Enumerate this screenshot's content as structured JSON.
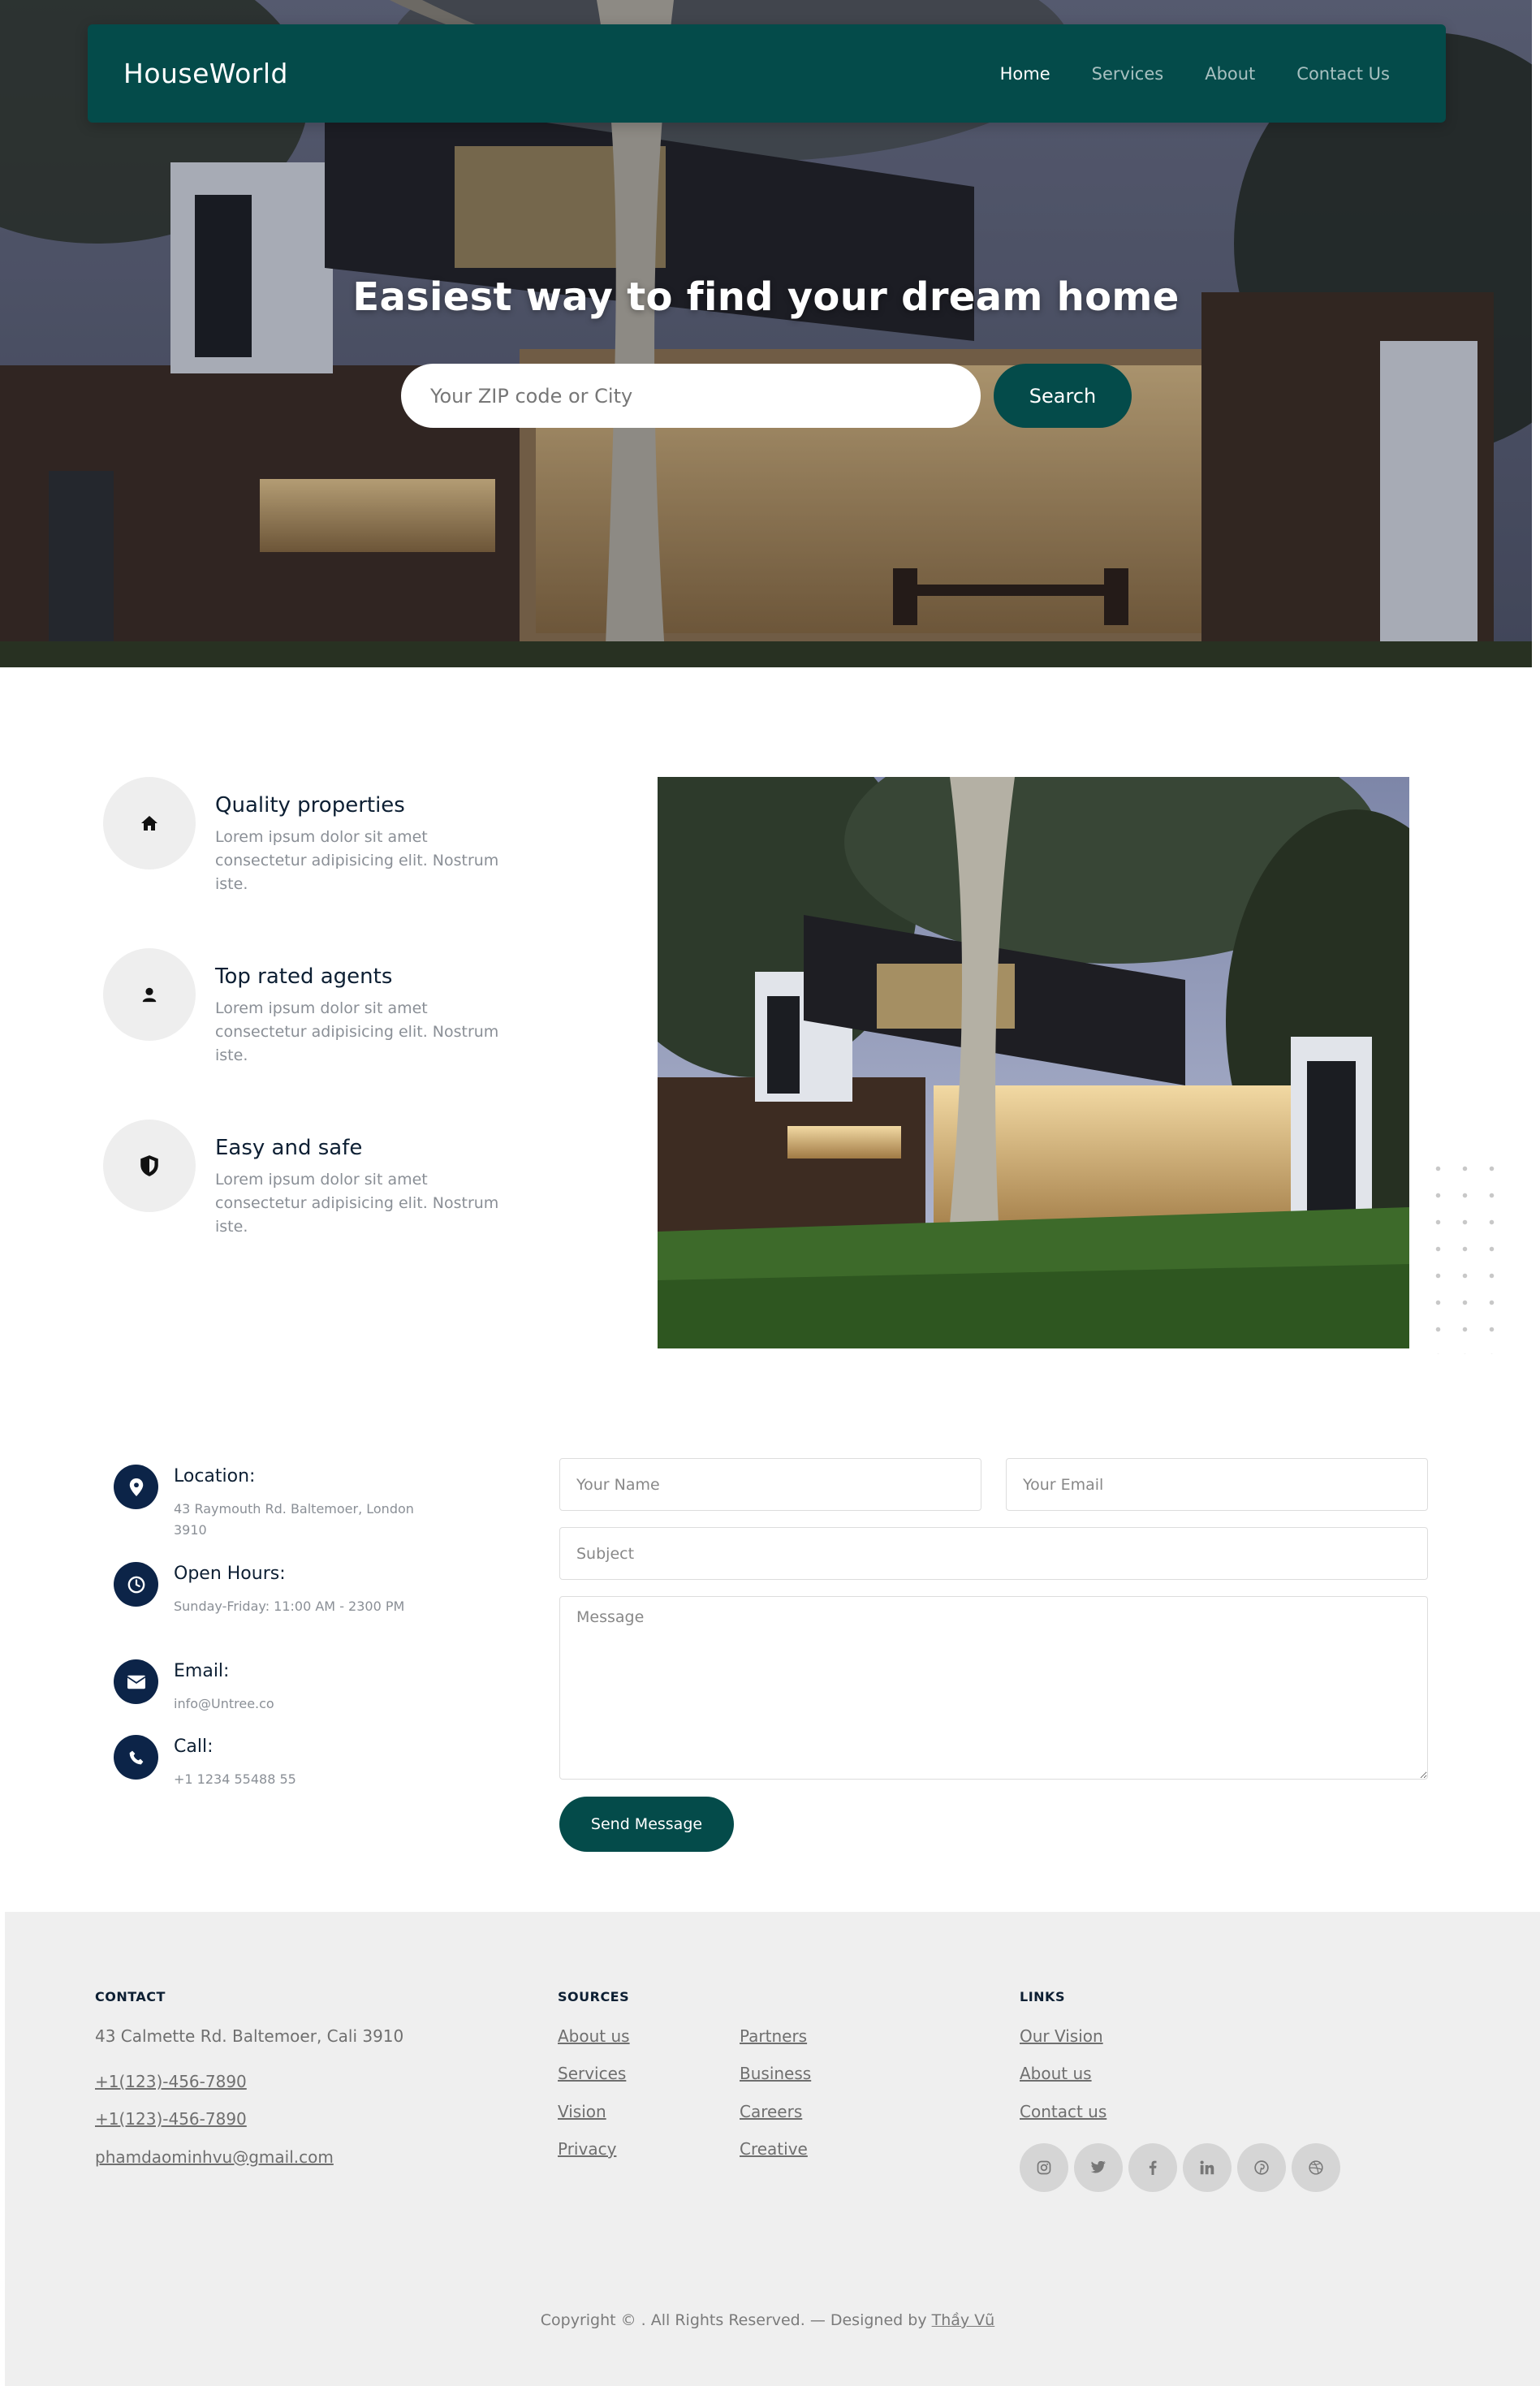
{
  "colors": {
    "primary": "#044b4a",
    "navy": "#0c2448",
    "feature_icon_bg": "#eeeeee",
    "footer_bg": "#efefef"
  },
  "navbar": {
    "brand": "HouseWorld",
    "links": [
      {
        "label": "Home",
        "active": true
      },
      {
        "label": "Services",
        "active": false
      },
      {
        "label": "About",
        "active": false
      },
      {
        "label": "Contact Us",
        "active": false
      }
    ]
  },
  "hero": {
    "title": "Easiest way to find your dream home",
    "search_placeholder": "Your ZIP code or City",
    "search_button": "Search"
  },
  "features": [
    {
      "icon": "home-icon",
      "title": "Quality properties",
      "text": "Lorem ipsum dolor sit amet consectetur adipisicing elit. Nostrum iste."
    },
    {
      "icon": "person-icon",
      "title": "Top rated agents",
      "text": "Lorem ipsum dolor sit amet consectetur adipisicing elit. Nostrum iste."
    },
    {
      "icon": "shield-icon",
      "title": "Easy and safe",
      "text": "Lorem ipsum dolor sit amet consectetur adipisicing elit. Nostrum iste."
    }
  ],
  "contact_info": [
    {
      "icon": "location-pin-icon",
      "title": "Location:",
      "text": "43 Raymouth Rd. Baltemoer, London 3910"
    },
    {
      "icon": "clock-icon",
      "title": "Open Hours:",
      "text": "Sunday-Friday: 11:00 AM - 2300 PM"
    },
    {
      "icon": "envelope-icon",
      "title": "Email:",
      "text": "info@Untree.co"
    },
    {
      "icon": "phone-icon",
      "title": "Call:",
      "text": "+1 1234 55488 55"
    }
  ],
  "form": {
    "name_placeholder": "Your Name",
    "email_placeholder": "Your Email",
    "subject_placeholder": "Subject",
    "message_placeholder": "Message",
    "send_button": "Send Message"
  },
  "footer": {
    "contact": {
      "heading": "CONTACT",
      "address": "43 Calmette Rd. Baltemoer, Cali 3910",
      "phone1": "+1(123)-456-7890",
      "phone2": "+1(123)-456-7890",
      "email": "phamdaominhvu@gmail.com"
    },
    "sources": {
      "heading": "SOURCES",
      "col1": [
        "About us",
        "Services",
        "Vision",
        "Privacy"
      ],
      "col2": [
        "Partners",
        "Business",
        "Careers",
        "Creative"
      ]
    },
    "links": {
      "heading": "LINKS",
      "items": [
        "Our Vision",
        "About us",
        "Contact us"
      ]
    },
    "social": [
      "instagram-icon",
      "twitter-icon",
      "facebook-icon",
      "linkedin-icon",
      "pinterest-icon",
      "dribbble-icon"
    ],
    "copyright_prefix": "Copyright © . All Rights Reserved. — Designed by",
    "designer": "Thầy Vũ"
  }
}
